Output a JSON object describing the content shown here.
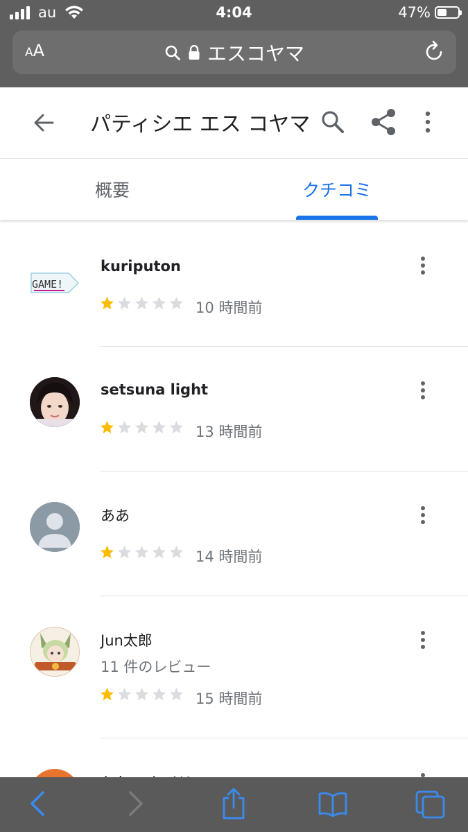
{
  "status_bar": {
    "carrier": "au",
    "time": "4:04",
    "battery": "47%",
    "battery_level": 0.47
  },
  "browser": {
    "text_size_label": "AA",
    "url_text": "エスコヤマ"
  },
  "header": {
    "title": "パティシエ エス コヤマ"
  },
  "tabs": [
    {
      "label": "概要",
      "active": false
    },
    {
      "label": "クチコミ",
      "active": true
    }
  ],
  "reviews": [
    {
      "name": "kuriputon",
      "subtitle": "",
      "rating": 1,
      "max_rating": 5,
      "time": "10 時間前",
      "avatar": "game-logo",
      "avatar_text": "GAME!"
    },
    {
      "name": "setsuna light",
      "subtitle": "",
      "rating": 1,
      "max_rating": 5,
      "time": "13 時間前",
      "avatar": "photo"
    },
    {
      "name": "ああ",
      "subtitle": "",
      "rating": 1,
      "max_rating": 5,
      "time": "14 時間前",
      "avatar": "default-person"
    },
    {
      "name": "Jun太郎",
      "subtitle": "11 件のレビュー",
      "rating": 1,
      "max_rating": 5,
      "time": "15 時間前",
      "avatar": "illustration"
    }
  ],
  "partial_review": {
    "name": "おおー ケイリ"
  },
  "colors": {
    "accent": "#1a73e8",
    "star_filled": "#fbbc04",
    "star_empty": "#dadce0",
    "chrome": "#5f5f5f"
  }
}
